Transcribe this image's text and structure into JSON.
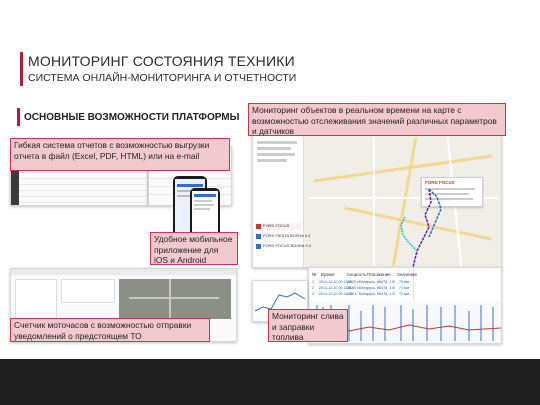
{
  "header": {
    "title": "МОНИТОРИНГ СОСТОЯНИЯ ТЕХНИКИ",
    "subtitle": "СИСТЕМА ОНЛАЙН-МОНИТОРИНГА И ОТЧЕТНОСТИ"
  },
  "section_heading": "ОСНОВНЫЕ ВОЗМОЖНОСТИ ПЛАТФОРМЫ",
  "callouts": {
    "reports": "Гибкая система отчетов с возможностью выгрузки отчета в файл (Excel, PDF, HTML) или на e-mail",
    "mobile": "Удобное мобильное приложение для iOS и Android",
    "realtime": "Мониторинг объектов в реальном времени на карте с возможностью отслеживания значений различных параметров и датчиков",
    "motohours": "Счетчик моточасов с возможностью отправки уведомлений о предстоящем ТО",
    "fuel": "Мониторинг слива и заправки топлива"
  },
  "table_screenshot": {
    "columns": [
      "Nr",
      "Время",
      "Скорость",
      "Положение",
      "Значение"
    ],
    "rows": [
      [
        "1",
        "2014-12-10 00:13:08",
        "25.20 к",
        "Беларусь, H8478, 1.05 km от Балахинки",
        "70 мм"
      ],
      [
        "2",
        "2014-12-10 00:13:40",
        "26.85 к",
        "Беларусь, H8478, 1.05 km от Балахинки",
        "71 мм"
      ],
      [
        "3",
        "2014-12-10 00:14:10",
        "4.50 к",
        "Беларусь, H8478, 1.05 km от Балахинки",
        "72 мм"
      ]
    ]
  },
  "map_screenshot": {
    "unit_label": "FORD FOCUS",
    "list_items": [
      "FORD FOCUS",
      "FORD FIESTA ВОЛНА 0.4",
      "FORD FOCUS ВОЛНА 0.4"
    ]
  },
  "colors": {
    "accent": "#b1203a",
    "callout_bg": "#f2c9cf",
    "footer": "#1e1e1e",
    "track_blue": "#2f6fd0",
    "track_purple": "#6a1fb0",
    "track_cyan": "#1fb8d8"
  }
}
